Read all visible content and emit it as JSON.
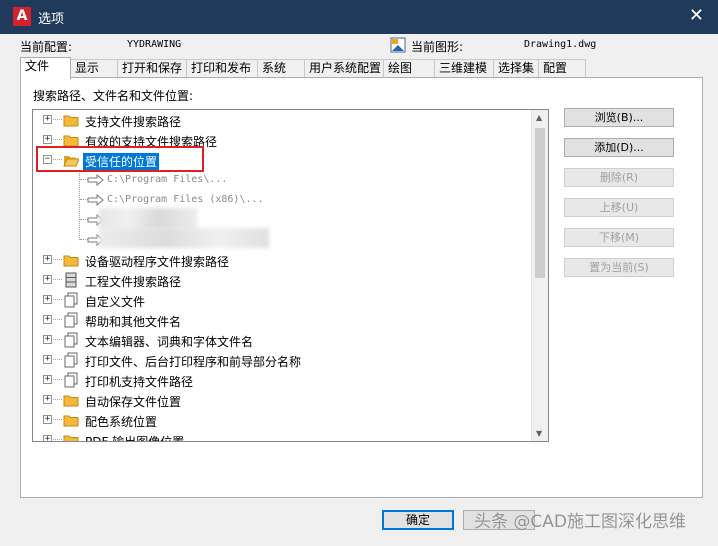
{
  "window": {
    "title": "选项",
    "app_icon_letter": "A",
    "close_glyph": "✕"
  },
  "profile": {
    "label": "当前配置:",
    "value": "YYDRAWING"
  },
  "drawing": {
    "label": "当前图形:",
    "value": "Drawing1.dwg"
  },
  "tabs": [
    "文件",
    "显示",
    "打开和保存",
    "打印和发布",
    "系统",
    "用户系统配置",
    "绘图",
    "三维建模",
    "选择集",
    "配置"
  ],
  "panel": {
    "search_label": "搜索路径、文件名和文件位置:"
  },
  "tree": {
    "items": [
      {
        "label": "支持文件搜索路径",
        "icon": "folder-icon"
      },
      {
        "label": "有效的支持文件搜索路径",
        "icon": "folder-icon"
      },
      {
        "label": "受信任的位置",
        "icon": "folder-open-icon",
        "expanded": true,
        "selected": true
      },
      {
        "label": "C:\\Program Files\\...",
        "icon": "arrow-icon"
      },
      {
        "label": "C:\\Program Files (x86)\\...",
        "icon": "arrow-icon"
      },
      {
        "label": "",
        "icon": "arrow-icon"
      },
      {
        "label": "",
        "icon": "arrow-icon"
      },
      {
        "label": "设备驱动程序文件搜索路径",
        "icon": "folder-icon"
      },
      {
        "label": "工程文件搜索路径",
        "icon": "cabinet-icon"
      },
      {
        "label": "自定义文件",
        "icon": "files-icon"
      },
      {
        "label": "帮助和其他文件名",
        "icon": "files-icon"
      },
      {
        "label": "文本编辑器、词典和字体文件名",
        "icon": "files-icon"
      },
      {
        "label": "打印文件、后台打印程序和前导部分名称",
        "icon": "files-icon"
      },
      {
        "label": "打印机支持文件路径",
        "icon": "files-icon"
      },
      {
        "label": "自动保存文件位置",
        "icon": "folder-icon"
      },
      {
        "label": "配色系统位置",
        "icon": "folder-icon"
      },
      {
        "label": "PDF 输出图像位置",
        "icon": "folder-icon"
      }
    ],
    "expander_collapsed": "+",
    "expander_expanded": "−"
  },
  "side_buttons": [
    {
      "label": "浏览(B)...",
      "enabled": true
    },
    {
      "label": "添加(D)...",
      "enabled": true
    },
    {
      "label": "删除(R)",
      "enabled": false
    },
    {
      "label": "上移(U)",
      "enabled": false
    },
    {
      "label": "下移(M)",
      "enabled": false
    },
    {
      "label": "置为当前(S)",
      "enabled": false
    }
  ],
  "bottom_buttons": {
    "ok": "确定",
    "cancel": ""
  },
  "watermark": "头条 @CAD施工图深化思维",
  "colors": {
    "titlebar": "#1f3a5a",
    "selection": "#0078d7",
    "highlight_box": "#e02020",
    "app_icon": "#d2232a"
  }
}
